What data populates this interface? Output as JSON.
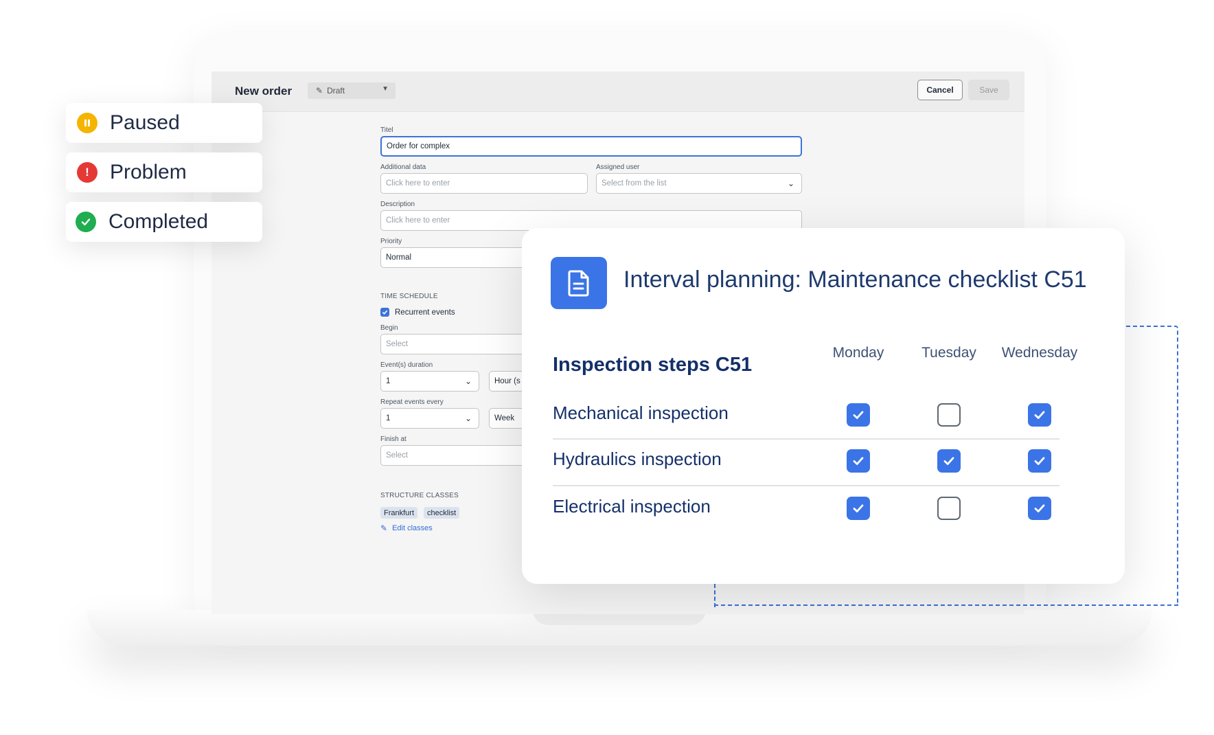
{
  "statuses": [
    {
      "label": "Paused",
      "color": "#f5b400",
      "icon": "pause-icon"
    },
    {
      "label": "Problem",
      "color": "#e53935",
      "icon": "exclamation-icon"
    },
    {
      "label": "Completed",
      "color": "#1fad4f",
      "icon": "check-icon"
    }
  ],
  "app": {
    "page_title": "New order",
    "status_value": "Draft",
    "cancel_label": "Cancel",
    "save_label": "Save"
  },
  "form": {
    "title_label": "Titel",
    "title_value": "Order for complex",
    "additional_label": "Additional data",
    "additional_placeholder": "Click here to enter",
    "assigned_label": "Assigned user",
    "assigned_placeholder": "Select from the list",
    "description_label": "Description",
    "description_placeholder": "Click here to enter",
    "priority_label": "Priority",
    "priority_value": "Normal",
    "time_schedule_heading": "TIME SCHEDULE",
    "recurrent_label": "Recurrent events",
    "begin_label": "Begin",
    "begin_placeholder": "Select",
    "duration_label": "Event(s) duration",
    "duration_value": "1",
    "duration_unit": "Hour (s",
    "repeat_label": "Repeat events every",
    "repeat_value": "1",
    "repeat_unit": "Week",
    "finish_label": "Finish at",
    "finish_placeholder": "Select",
    "structure_heading": "STRUCTURE CLASSES",
    "tags": [
      "Frankfurt",
      "checklist"
    ],
    "edit_classes_label": "Edit classes"
  },
  "card": {
    "title": "Interval planning: Maintenance checklist C51",
    "steps_heading": "Inspection steps C51",
    "days": [
      "Monday",
      "Tuesday",
      "Wednesday"
    ],
    "rows": [
      {
        "label": "Mechanical inspection",
        "checks": [
          true,
          false,
          true
        ]
      },
      {
        "label": "Hydraulics inspection",
        "checks": [
          true,
          true,
          true
        ]
      },
      {
        "label": "Electrical inspection",
        "checks": [
          true,
          false,
          true
        ]
      }
    ]
  }
}
